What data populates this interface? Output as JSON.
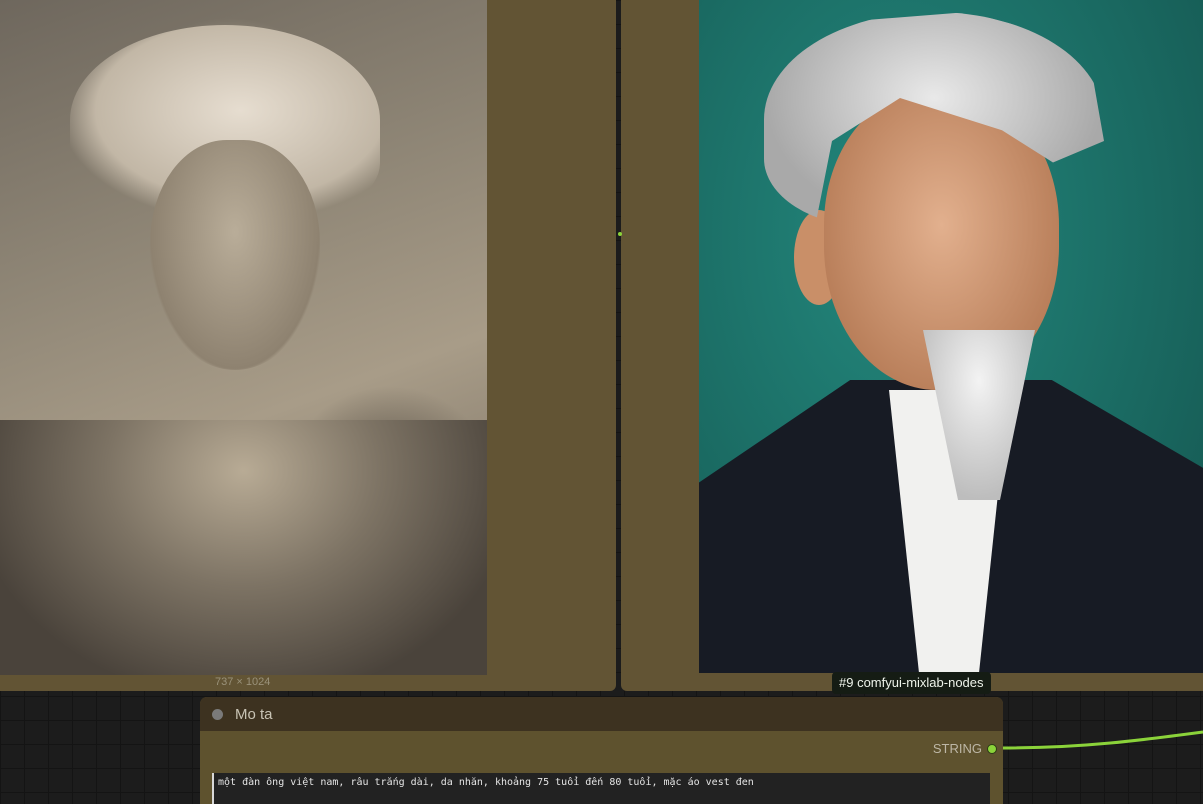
{
  "left_node": {
    "image_size": "737 × 1024"
  },
  "right_node": {
    "tooltip": "#9 comfyui-mixlab-nodes"
  },
  "mota_node": {
    "title": "Mo ta",
    "output_label": "STRING",
    "prompt_value": "một đàn ông việt nam, râu trắng dài, da nhăn, khoảng 75 tuổi đến 80 tuổi, mặc áo vest đen"
  },
  "colors": {
    "node_bg": "#625434",
    "wire": "#8bd33a"
  }
}
